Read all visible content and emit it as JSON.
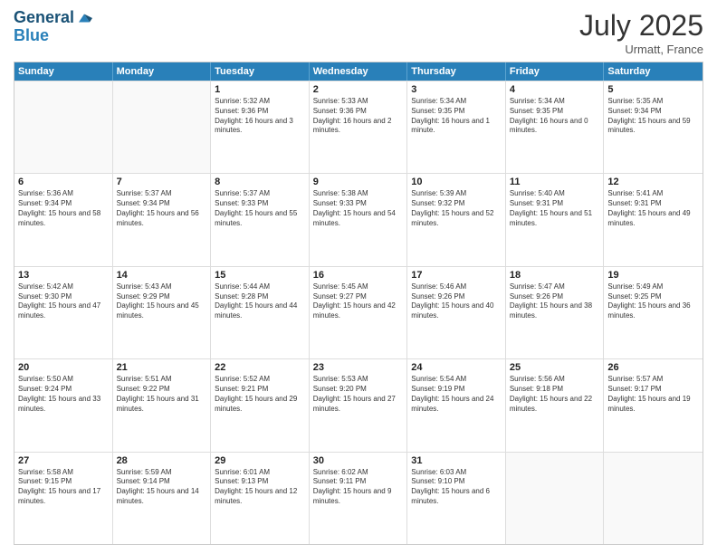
{
  "header": {
    "logo_line1": "General",
    "logo_line2": "Blue",
    "month_year": "July 2025",
    "location": "Urmatt, France"
  },
  "days_of_week": [
    "Sunday",
    "Monday",
    "Tuesday",
    "Wednesday",
    "Thursday",
    "Friday",
    "Saturday"
  ],
  "rows": [
    [
      {
        "day": "",
        "info": "",
        "empty": true
      },
      {
        "day": "",
        "info": "",
        "empty": true
      },
      {
        "day": "1",
        "info": "Sunrise: 5:32 AM\nSunset: 9:36 PM\nDaylight: 16 hours and 3 minutes."
      },
      {
        "day": "2",
        "info": "Sunrise: 5:33 AM\nSunset: 9:36 PM\nDaylight: 16 hours and 2 minutes."
      },
      {
        "day": "3",
        "info": "Sunrise: 5:34 AM\nSunset: 9:35 PM\nDaylight: 16 hours and 1 minute."
      },
      {
        "day": "4",
        "info": "Sunrise: 5:34 AM\nSunset: 9:35 PM\nDaylight: 16 hours and 0 minutes."
      },
      {
        "day": "5",
        "info": "Sunrise: 5:35 AM\nSunset: 9:34 PM\nDaylight: 15 hours and 59 minutes."
      }
    ],
    [
      {
        "day": "6",
        "info": "Sunrise: 5:36 AM\nSunset: 9:34 PM\nDaylight: 15 hours and 58 minutes."
      },
      {
        "day": "7",
        "info": "Sunrise: 5:37 AM\nSunset: 9:34 PM\nDaylight: 15 hours and 56 minutes."
      },
      {
        "day": "8",
        "info": "Sunrise: 5:37 AM\nSunset: 9:33 PM\nDaylight: 15 hours and 55 minutes."
      },
      {
        "day": "9",
        "info": "Sunrise: 5:38 AM\nSunset: 9:33 PM\nDaylight: 15 hours and 54 minutes."
      },
      {
        "day": "10",
        "info": "Sunrise: 5:39 AM\nSunset: 9:32 PM\nDaylight: 15 hours and 52 minutes."
      },
      {
        "day": "11",
        "info": "Sunrise: 5:40 AM\nSunset: 9:31 PM\nDaylight: 15 hours and 51 minutes."
      },
      {
        "day": "12",
        "info": "Sunrise: 5:41 AM\nSunset: 9:31 PM\nDaylight: 15 hours and 49 minutes."
      }
    ],
    [
      {
        "day": "13",
        "info": "Sunrise: 5:42 AM\nSunset: 9:30 PM\nDaylight: 15 hours and 47 minutes."
      },
      {
        "day": "14",
        "info": "Sunrise: 5:43 AM\nSunset: 9:29 PM\nDaylight: 15 hours and 45 minutes."
      },
      {
        "day": "15",
        "info": "Sunrise: 5:44 AM\nSunset: 9:28 PM\nDaylight: 15 hours and 44 minutes."
      },
      {
        "day": "16",
        "info": "Sunrise: 5:45 AM\nSunset: 9:27 PM\nDaylight: 15 hours and 42 minutes."
      },
      {
        "day": "17",
        "info": "Sunrise: 5:46 AM\nSunset: 9:26 PM\nDaylight: 15 hours and 40 minutes."
      },
      {
        "day": "18",
        "info": "Sunrise: 5:47 AM\nSunset: 9:26 PM\nDaylight: 15 hours and 38 minutes."
      },
      {
        "day": "19",
        "info": "Sunrise: 5:49 AM\nSunset: 9:25 PM\nDaylight: 15 hours and 36 minutes."
      }
    ],
    [
      {
        "day": "20",
        "info": "Sunrise: 5:50 AM\nSunset: 9:24 PM\nDaylight: 15 hours and 33 minutes."
      },
      {
        "day": "21",
        "info": "Sunrise: 5:51 AM\nSunset: 9:22 PM\nDaylight: 15 hours and 31 minutes."
      },
      {
        "day": "22",
        "info": "Sunrise: 5:52 AM\nSunset: 9:21 PM\nDaylight: 15 hours and 29 minutes."
      },
      {
        "day": "23",
        "info": "Sunrise: 5:53 AM\nSunset: 9:20 PM\nDaylight: 15 hours and 27 minutes."
      },
      {
        "day": "24",
        "info": "Sunrise: 5:54 AM\nSunset: 9:19 PM\nDaylight: 15 hours and 24 minutes."
      },
      {
        "day": "25",
        "info": "Sunrise: 5:56 AM\nSunset: 9:18 PM\nDaylight: 15 hours and 22 minutes."
      },
      {
        "day": "26",
        "info": "Sunrise: 5:57 AM\nSunset: 9:17 PM\nDaylight: 15 hours and 19 minutes."
      }
    ],
    [
      {
        "day": "27",
        "info": "Sunrise: 5:58 AM\nSunset: 9:15 PM\nDaylight: 15 hours and 17 minutes."
      },
      {
        "day": "28",
        "info": "Sunrise: 5:59 AM\nSunset: 9:14 PM\nDaylight: 15 hours and 14 minutes."
      },
      {
        "day": "29",
        "info": "Sunrise: 6:01 AM\nSunset: 9:13 PM\nDaylight: 15 hours and 12 minutes."
      },
      {
        "day": "30",
        "info": "Sunrise: 6:02 AM\nSunset: 9:11 PM\nDaylight: 15 hours and 9 minutes."
      },
      {
        "day": "31",
        "info": "Sunrise: 6:03 AM\nSunset: 9:10 PM\nDaylight: 15 hours and 6 minutes."
      },
      {
        "day": "",
        "info": "",
        "empty": true
      },
      {
        "day": "",
        "info": "",
        "empty": true
      }
    ]
  ]
}
